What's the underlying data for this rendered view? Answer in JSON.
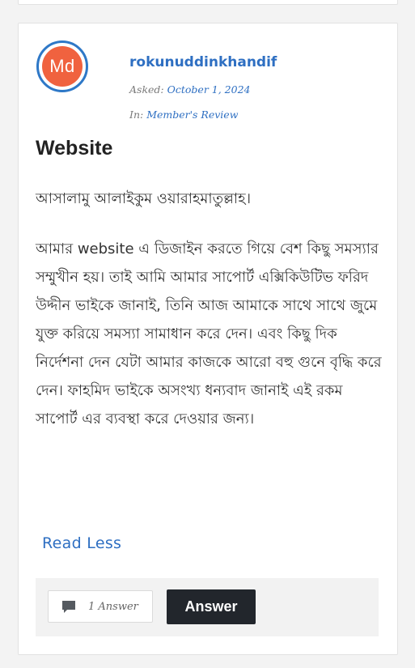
{
  "post": {
    "avatar_initials": "Md",
    "username": "rokunuddinkhandif",
    "asked_label": "Asked:",
    "asked_date": "October 1, 2024",
    "in_label": "In:",
    "category": "Member's Review",
    "title": "Website",
    "paragraphs": [
      "আসালামু আলাইকুম ওয়ারাহমাতুল্লাহ।",
      "আমার website এ ডিজাইন করতে গিয়ে বেশ কিছু  সমস্যার সম্মুখীন হয়। তাই আমি আমার সাপোর্ট এক্সিকিউটিভ ফরিদ উদ্দীন ভাইকে জানাই, তিনি আজ আমাকে সাথে সাথে জুমে যুক্ত করিয়ে সমস্যা সামাধান করে দেন। এবং কিছু দিক নির্দেশনা দেন যেটা আমার কাজকে আরো বহু গুনে বৃদ্ধি করে দেন। ফাহমিদ ভাইকে অসংখ্য ধন্যবাদ জানাই এই রকম সাপোর্ট এর ব্যবস্থা করে দেওয়ার জন্য।"
    ],
    "read_less_label": "Read Less"
  },
  "footer": {
    "answers_count_label": "1 Answer",
    "answer_button_label": "Answer",
    "comment_icon": "comment-icon"
  },
  "colors": {
    "link": "#2e6fc2",
    "avatar_ring": "#2e78c7",
    "avatar_fill": "#f0623f",
    "answer_button_bg": "#22262c"
  }
}
